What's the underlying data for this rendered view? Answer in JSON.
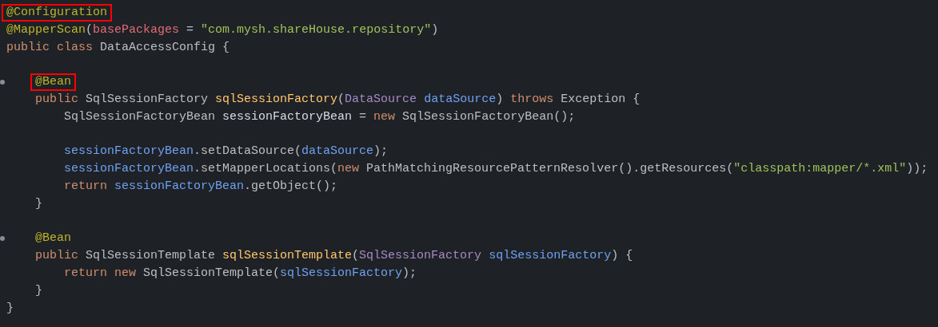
{
  "editor": {
    "lines": [
      {
        "kind": "code",
        "boxed": true,
        "marker": false,
        "tokens": [
          {
            "kind": "annotation",
            "text": "@Configuration"
          }
        ]
      },
      {
        "kind": "code",
        "boxed": false,
        "marker": false,
        "tokens": [
          {
            "kind": "annotation",
            "text": "@MapperScan"
          },
          {
            "kind": "plain",
            "text": "("
          },
          {
            "kind": "attribute",
            "text": "basePackages"
          },
          {
            "kind": "plain",
            "text": " = "
          },
          {
            "kind": "string",
            "text": "\"com.mysh.shareHouse.repository\""
          },
          {
            "kind": "plain",
            "text": ")"
          }
        ]
      },
      {
        "kind": "code",
        "boxed": false,
        "marker": false,
        "tokens": [
          {
            "kind": "keyword",
            "text": "public class "
          },
          {
            "kind": "plain",
            "text": "DataAccessConfig {"
          }
        ],
        "children": [
          {
            "kind": "blank"
          },
          {
            "kind": "code",
            "boxed": true,
            "marker": true,
            "tokens": [
              {
                "kind": "annotation",
                "text": "@Bean"
              }
            ]
          },
          {
            "kind": "code",
            "boxed": false,
            "marker": false,
            "tokens": [
              {
                "kind": "keyword",
                "text": "public "
              },
              {
                "kind": "plain",
                "text": "SqlSessionFactory "
              },
              {
                "kind": "method",
                "text": "sqlSessionFactory"
              },
              {
                "kind": "plain",
                "text": "("
              },
              {
                "kind": "class",
                "text": "DataSource "
              },
              {
                "kind": "param",
                "text": "dataSource"
              },
              {
                "kind": "plain",
                "text": ") "
              },
              {
                "kind": "keyword",
                "text": "throws "
              },
              {
                "kind": "plain",
                "text": "Exception {"
              }
            ],
            "children": [
              {
                "kind": "code",
                "boxed": false,
                "marker": false,
                "tokens": [
                  {
                    "kind": "plain",
                    "text": "SqlSessionFactoryBean "
                  },
                  {
                    "kind": "variable",
                    "text": "sessionFactoryBean"
                  },
                  {
                    "kind": "plain",
                    "text": " = "
                  },
                  {
                    "kind": "keyword",
                    "text": "new "
                  },
                  {
                    "kind": "plain",
                    "text": "SqlSessionFactoryBean();"
                  }
                ]
              },
              {
                "kind": "blank"
              },
              {
                "kind": "code",
                "boxed": false,
                "marker": false,
                "tokens": [
                  {
                    "kind": "param",
                    "text": "sessionFactoryBean"
                  },
                  {
                    "kind": "plain",
                    "text": ".setDataSource("
                  },
                  {
                    "kind": "param",
                    "text": "dataSource"
                  },
                  {
                    "kind": "plain",
                    "text": ");"
                  }
                ]
              },
              {
                "kind": "code",
                "boxed": false,
                "marker": false,
                "tokens": [
                  {
                    "kind": "param",
                    "text": "sessionFactoryBean"
                  },
                  {
                    "kind": "plain",
                    "text": ".setMapperLocations("
                  },
                  {
                    "kind": "keyword",
                    "text": "new "
                  },
                  {
                    "kind": "plain",
                    "text": "PathMatchingResourcePatternResolver().getResources("
                  },
                  {
                    "kind": "string",
                    "text": "\"classpath:mapper/*.xml\""
                  },
                  {
                    "kind": "plain",
                    "text": "));"
                  }
                ]
              },
              {
                "kind": "code",
                "boxed": false,
                "marker": false,
                "tokens": [
                  {
                    "kind": "keyword",
                    "text": "return "
                  },
                  {
                    "kind": "param",
                    "text": "sessionFactoryBean"
                  },
                  {
                    "kind": "plain",
                    "text": ".getObject();"
                  }
                ]
              }
            ]
          },
          {
            "kind": "code",
            "boxed": false,
            "marker": false,
            "tokens": [
              {
                "kind": "plain",
                "text": "}"
              }
            ]
          },
          {
            "kind": "blank"
          },
          {
            "kind": "code",
            "boxed": false,
            "marker": true,
            "tokens": [
              {
                "kind": "annotation",
                "text": "@Bean"
              }
            ]
          },
          {
            "kind": "code",
            "boxed": false,
            "marker": false,
            "tokens": [
              {
                "kind": "keyword",
                "text": "public "
              },
              {
                "kind": "plain",
                "text": "SqlSessionTemplate "
              },
              {
                "kind": "method",
                "text": "sqlSessionTemplate"
              },
              {
                "kind": "plain",
                "text": "("
              },
              {
                "kind": "class",
                "text": "SqlSessionFactory "
              },
              {
                "kind": "param",
                "text": "sqlSessionFactory"
              },
              {
                "kind": "plain",
                "text": ") {"
              }
            ],
            "children": [
              {
                "kind": "code",
                "boxed": false,
                "marker": false,
                "tokens": [
                  {
                    "kind": "keyword",
                    "text": "return new "
                  },
                  {
                    "kind": "plain",
                    "text": "SqlSessionTemplate("
                  },
                  {
                    "kind": "param",
                    "text": "sqlSessionFactory"
                  },
                  {
                    "kind": "plain",
                    "text": ");"
                  }
                ]
              }
            ]
          },
          {
            "kind": "code",
            "boxed": false,
            "marker": false,
            "tokens": [
              {
                "kind": "plain",
                "text": "}"
              }
            ]
          }
        ]
      },
      {
        "kind": "code",
        "boxed": false,
        "marker": false,
        "tokens": [
          {
            "kind": "plain",
            "text": "}"
          }
        ]
      }
    ]
  }
}
